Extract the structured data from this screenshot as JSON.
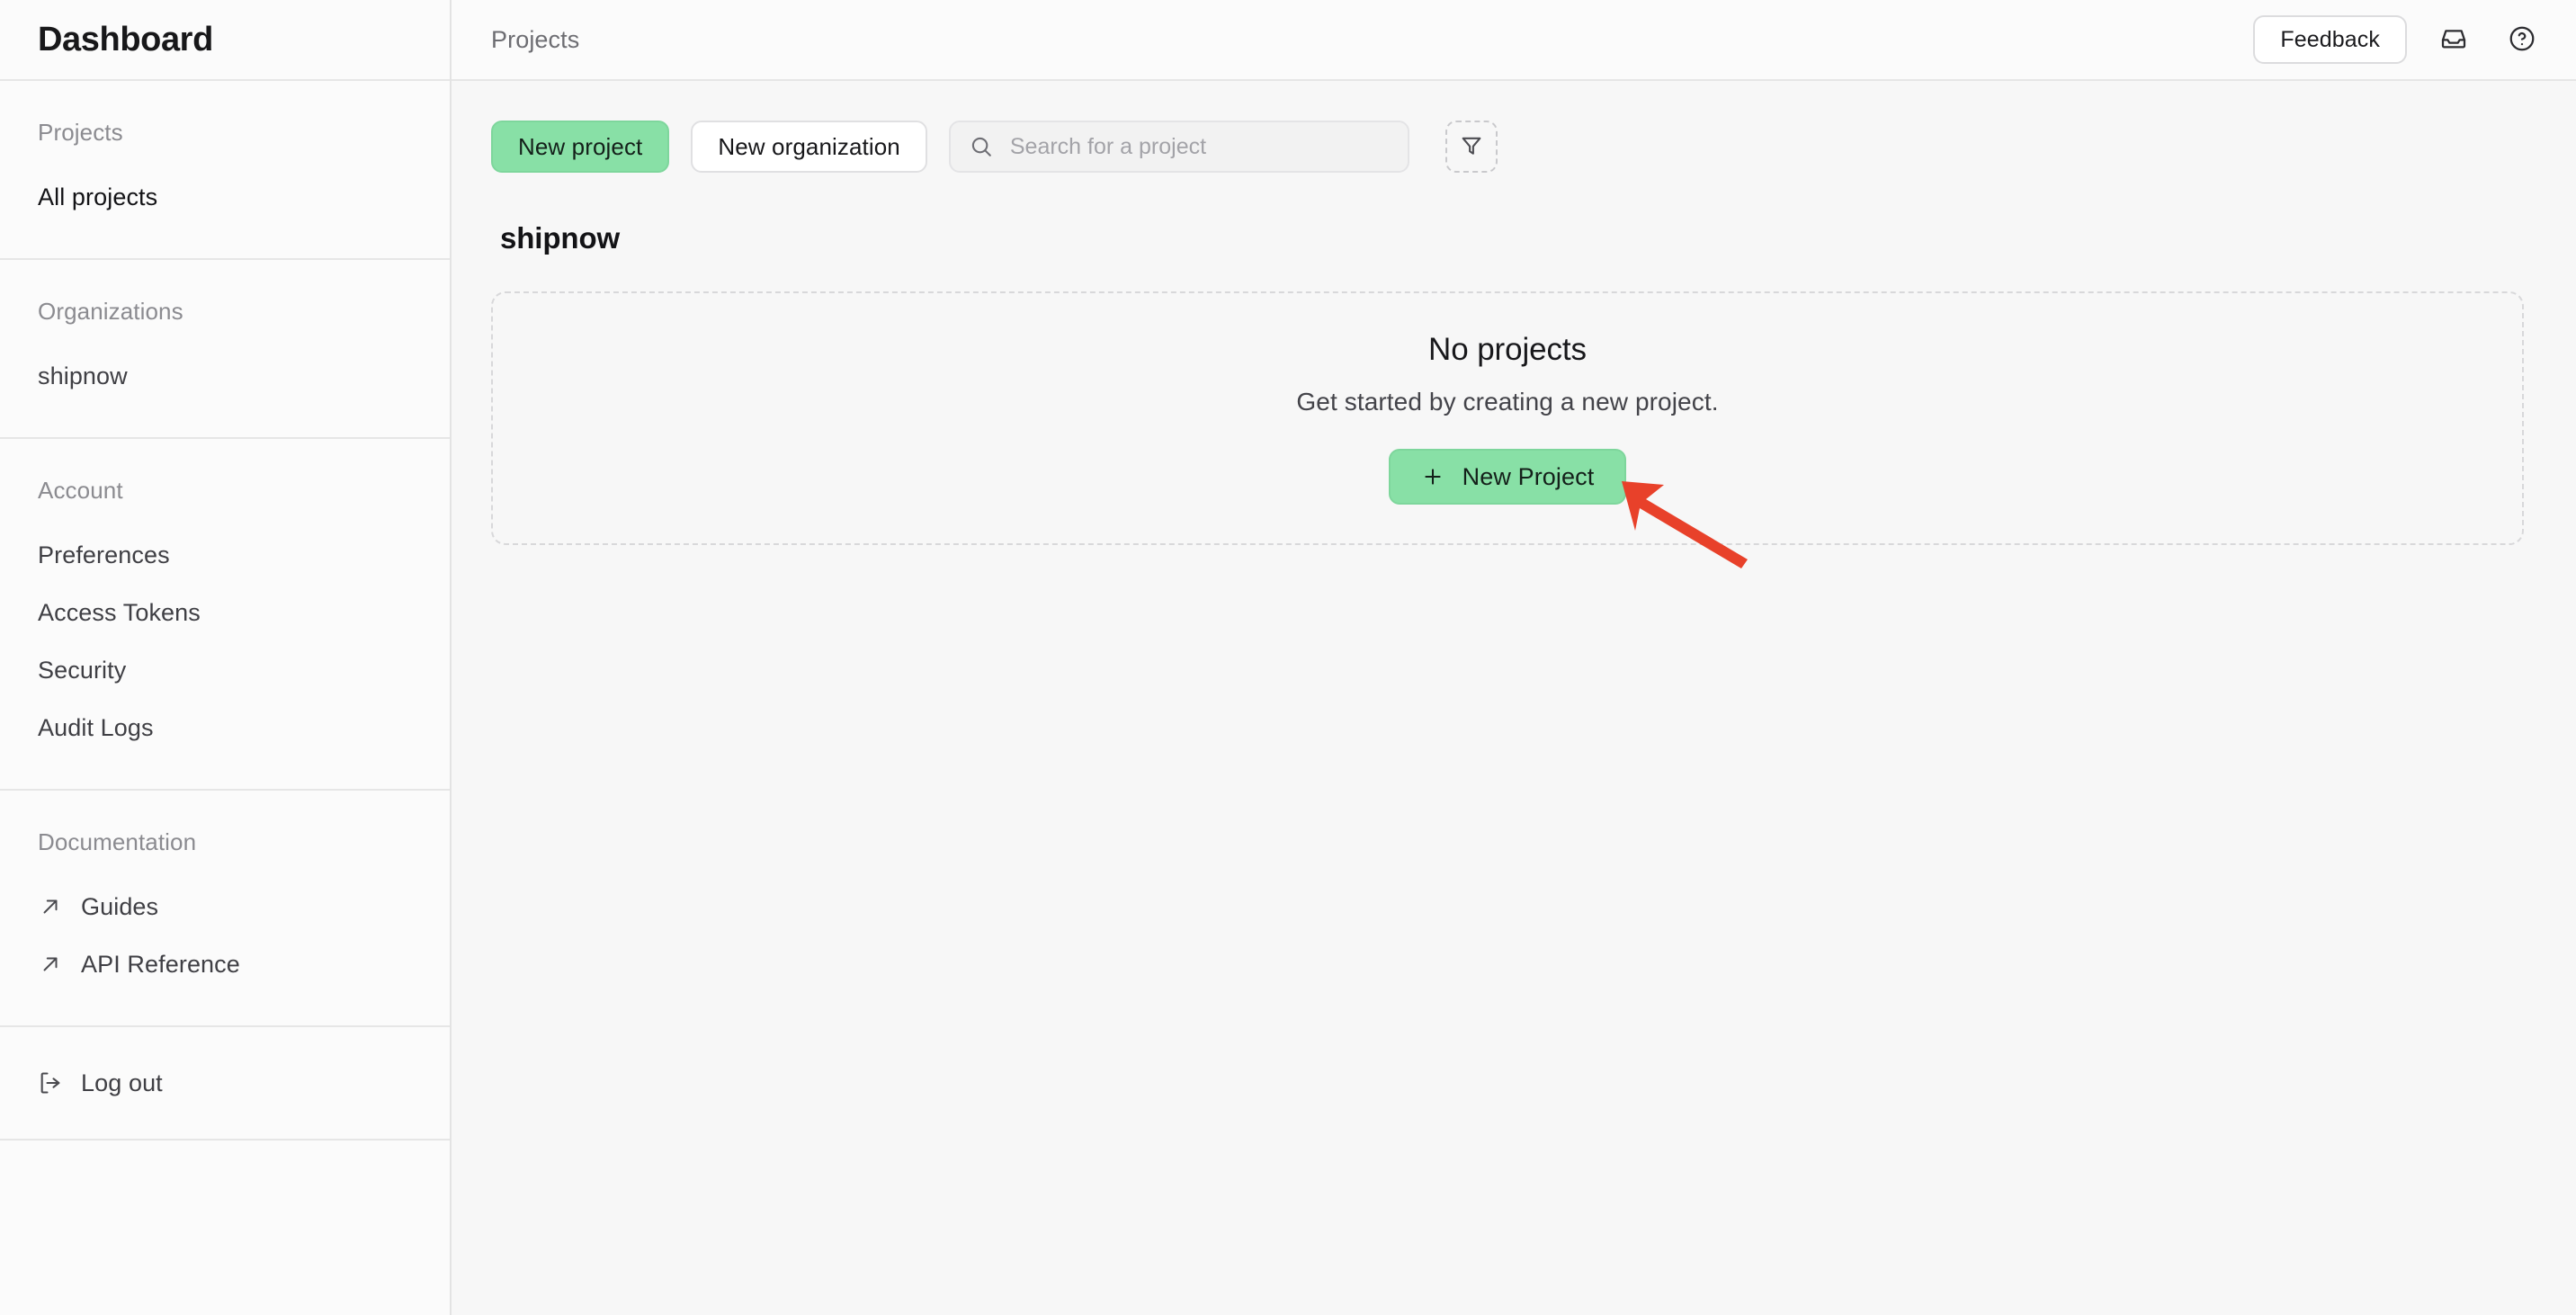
{
  "sidebar": {
    "title": "Dashboard",
    "sections": [
      {
        "heading": "Projects",
        "items": [
          {
            "label": "All projects",
            "icon": "",
            "active": true
          }
        ]
      },
      {
        "heading": "Organizations",
        "items": [
          {
            "label": "shipnow",
            "icon": "",
            "active": false
          }
        ]
      },
      {
        "heading": "Account",
        "items": [
          {
            "label": "Preferences",
            "icon": "",
            "active": false
          },
          {
            "label": "Access Tokens",
            "icon": "",
            "active": false
          },
          {
            "label": "Security",
            "icon": "",
            "active": false
          },
          {
            "label": "Audit Logs",
            "icon": "",
            "active": false
          }
        ]
      },
      {
        "heading": "Documentation",
        "items": [
          {
            "label": "Guides",
            "icon": "external-link-icon",
            "active": false
          },
          {
            "label": "API Reference",
            "icon": "external-link-icon",
            "active": false
          }
        ]
      }
    ],
    "logout": {
      "label": "Log out",
      "icon": "logout-icon"
    }
  },
  "topbar": {
    "breadcrumb": "Projects",
    "feedback_label": "Feedback",
    "inbox_icon": "inbox-icon",
    "help_icon": "help-circle-icon"
  },
  "toolbar": {
    "new_project_label": "New project",
    "new_organization_label": "New organization",
    "search_placeholder": "Search for a project",
    "search_value": "",
    "search_icon": "search-icon",
    "filter_icon": "filter-icon"
  },
  "main": {
    "org_heading": "shipnow",
    "empty_state": {
      "title": "No projects",
      "subtitle": "Get started by creating a new project.",
      "button_label": "New Project",
      "button_icon": "plus-icon"
    }
  },
  "annotation": {
    "type": "arrow",
    "color": "#e8412a",
    "points_to": "new-project-empty-button"
  },
  "colors": {
    "accent_green": "#88e0a6",
    "annotation_red": "#e8412a",
    "sidebar_bg": "#fbfbfb",
    "main_bg": "#f7f7f7",
    "border": "#e6e6e6"
  }
}
